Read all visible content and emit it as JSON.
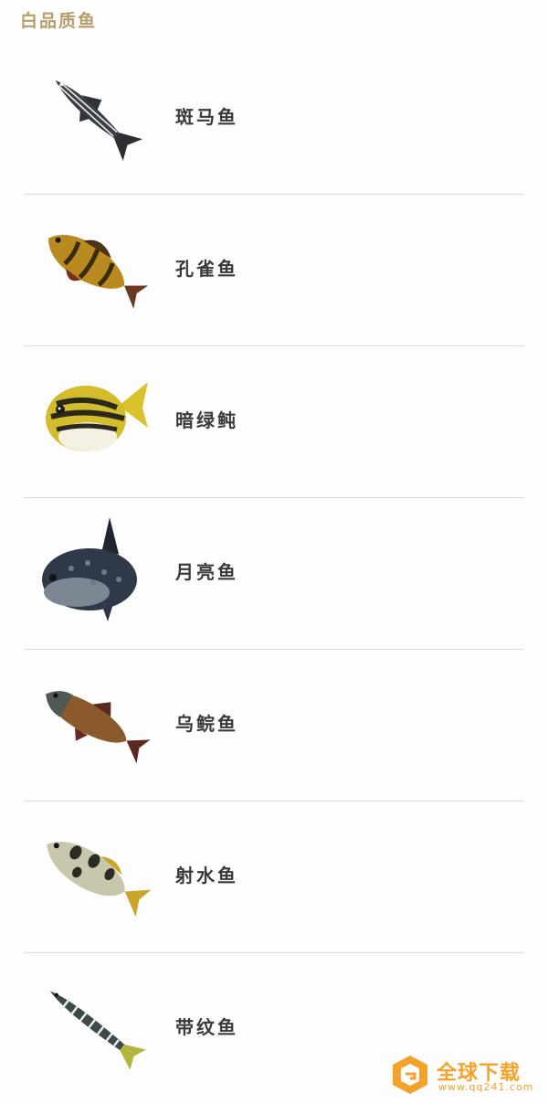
{
  "page": {
    "title": "白品质鱼"
  },
  "fishes": [
    {
      "name": "斑马鱼",
      "icon": "zebra-fish-icon"
    },
    {
      "name": "孔雀鱼",
      "icon": "peacock-fish-icon"
    },
    {
      "name": "暗绿鲀",
      "icon": "pufferfish-icon"
    },
    {
      "name": "月亮鱼",
      "icon": "sunfish-icon"
    },
    {
      "name": "乌鲩鱼",
      "icon": "grass-carp-icon"
    },
    {
      "name": "射水鱼",
      "icon": "archer-fish-icon"
    },
    {
      "name": "带纹鱼",
      "icon": "banded-fish-icon"
    }
  ],
  "watermark": {
    "brand": "全球下载",
    "url": "www.qq241.com"
  },
  "colors": {
    "title": "#b89c6a",
    "text": "#3a3a3a",
    "divider": "#dcdcdc",
    "watermark": "#f3a22a"
  }
}
